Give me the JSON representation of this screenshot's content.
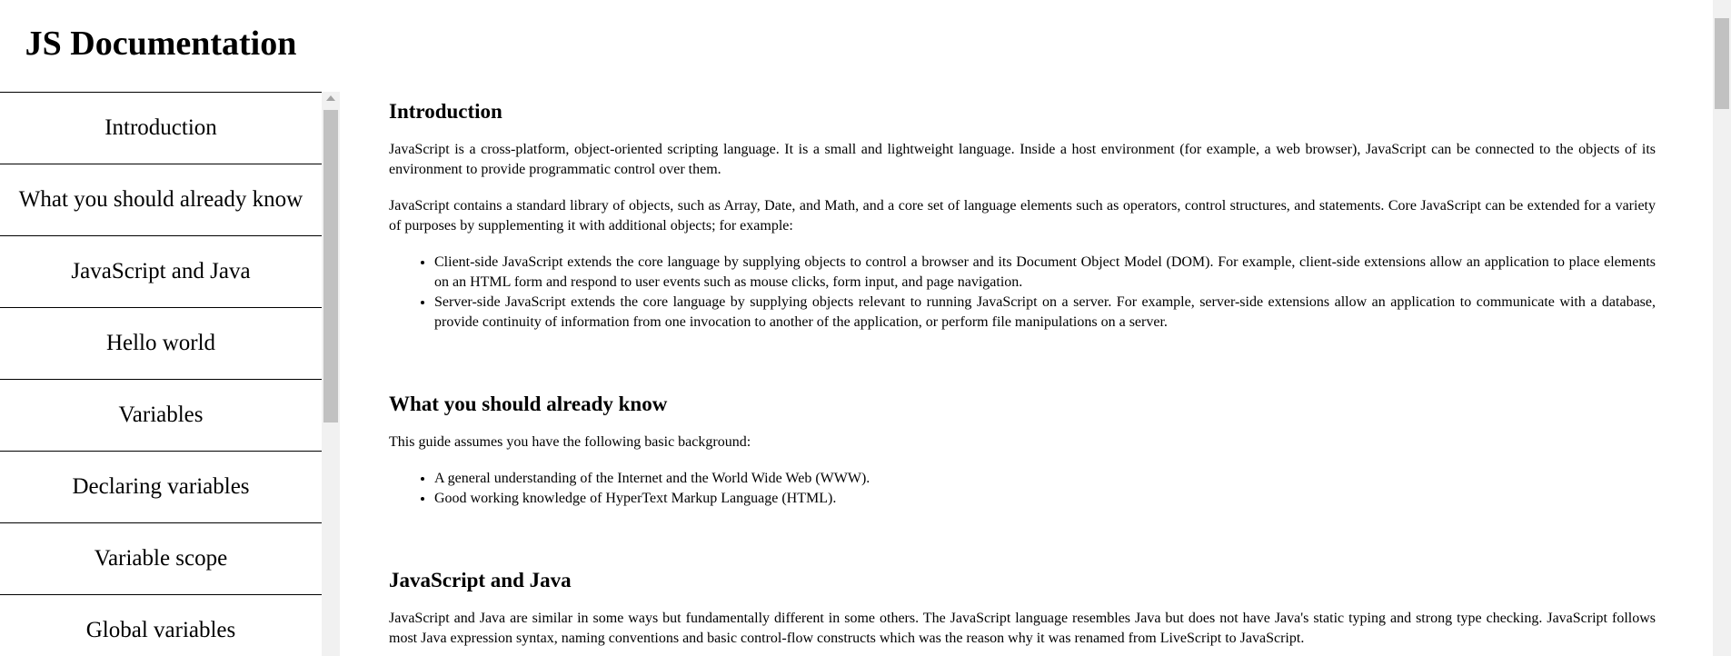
{
  "navbar": {
    "title": "JS Documentation",
    "items": [
      {
        "label": "Introduction"
      },
      {
        "label": "What you should already know"
      },
      {
        "label": "JavaScript and Java"
      },
      {
        "label": "Hello world"
      },
      {
        "label": "Variables"
      },
      {
        "label": "Declaring variables"
      },
      {
        "label": "Variable scope"
      },
      {
        "label": "Global variables"
      }
    ]
  },
  "main": {
    "sections": [
      {
        "heading": "Introduction",
        "paragraphs": [
          "JavaScript is a cross-platform, object-oriented scripting language. It is a small and lightweight language. Inside a host environment (for example, a web browser), JavaScript can be connected to the objects of its environment to provide programmatic control over them.",
          "JavaScript contains a standard library of objects, such as Array, Date, and Math, and a core set of language elements such as operators, control structures, and statements. Core JavaScript can be extended for a variety of purposes by supplementing it with additional objects; for example:"
        ],
        "list": [
          "Client-side JavaScript extends the core language by supplying objects to control a browser and its Document Object Model (DOM). For example, client-side extensions allow an application to place elements on an HTML form and respond to user events such as mouse clicks, form input, and page navigation.",
          "Server-side JavaScript extends the core language by supplying objects relevant to running JavaScript on a server. For example, server-side extensions allow an application to communicate with a database, provide continuity of information from one invocation to another of the application, or perform file manipulations on a server."
        ]
      },
      {
        "heading": "What you should already know",
        "paragraphs": [
          "This guide assumes you have the following basic background:"
        ],
        "list": [
          "A general understanding of the Internet and the World Wide Web (WWW).",
          "Good working knowledge of HyperText Markup Language (HTML)."
        ]
      },
      {
        "heading": "JavaScript and Java",
        "paragraphs": [
          "JavaScript and Java are similar in some ways but fundamentally different in some others. The JavaScript language resembles Java but does not have Java's static typing and strong type checking. JavaScript follows most Java expression syntax, naming conventions and basic control-flow constructs which was the reason why it was renamed from LiveScript to JavaScript."
        ]
      }
    ]
  }
}
